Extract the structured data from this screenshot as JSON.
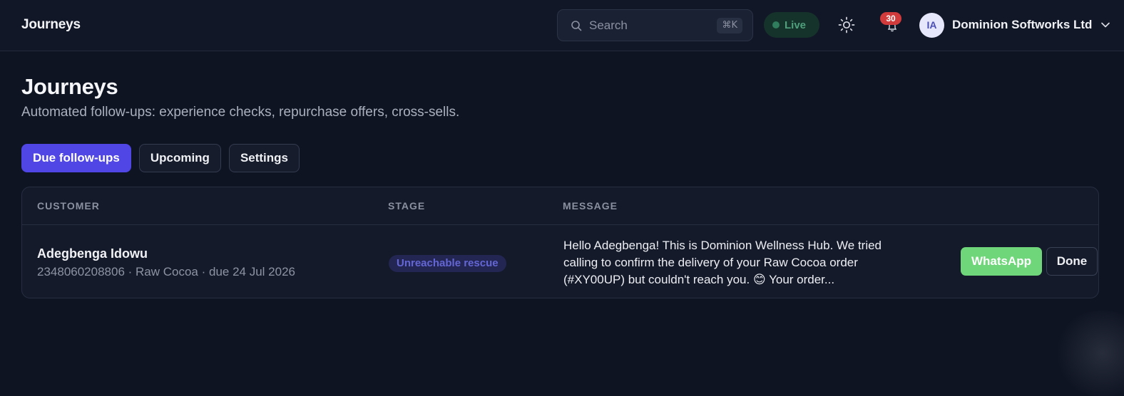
{
  "header": {
    "brand": "Journeys",
    "search": {
      "placeholder": "Search",
      "shortcut": "⌘K"
    },
    "live_label": "Live",
    "notifications_count": "30",
    "account": {
      "initials": "IA",
      "name": "Dominion Softworks Ltd"
    },
    "icons": {
      "search": "search-icon",
      "theme": "sun-icon",
      "notifications": "bell-icon",
      "account_menu": "chevron-down-icon"
    }
  },
  "page": {
    "title": "Journeys",
    "subtitle": "Automated follow-ups: experience checks, repurchase offers, cross-sells."
  },
  "tabs": [
    {
      "label": "Due follow-ups",
      "active": true
    },
    {
      "label": "Upcoming",
      "active": false
    },
    {
      "label": "Settings",
      "active": false
    }
  ],
  "table": {
    "columns": [
      "CUSTOMER",
      "STAGE",
      "MESSAGE"
    ],
    "rows": [
      {
        "customer_name": "Adegbenga Idowu",
        "customer_meta": "2348060208806 · Raw Cocoa · due 24 Jul 2026",
        "stage": "Unreachable rescue",
        "message": "Hello Adegbenga! This is Dominion Wellness Hub. We tried calling to confirm the delivery of your Raw Cocoa order (#XY00UP) but couldn't reach you. 😊 Your order...",
        "actions": {
          "primary": "WhatsApp",
          "secondary": "Done"
        }
      }
    ]
  },
  "colors": {
    "background": "#0f1423",
    "accent": "#4f46e5",
    "whatsapp": "#6fd67a",
    "live": "#4fa07c",
    "badge": "#d23b3b"
  }
}
